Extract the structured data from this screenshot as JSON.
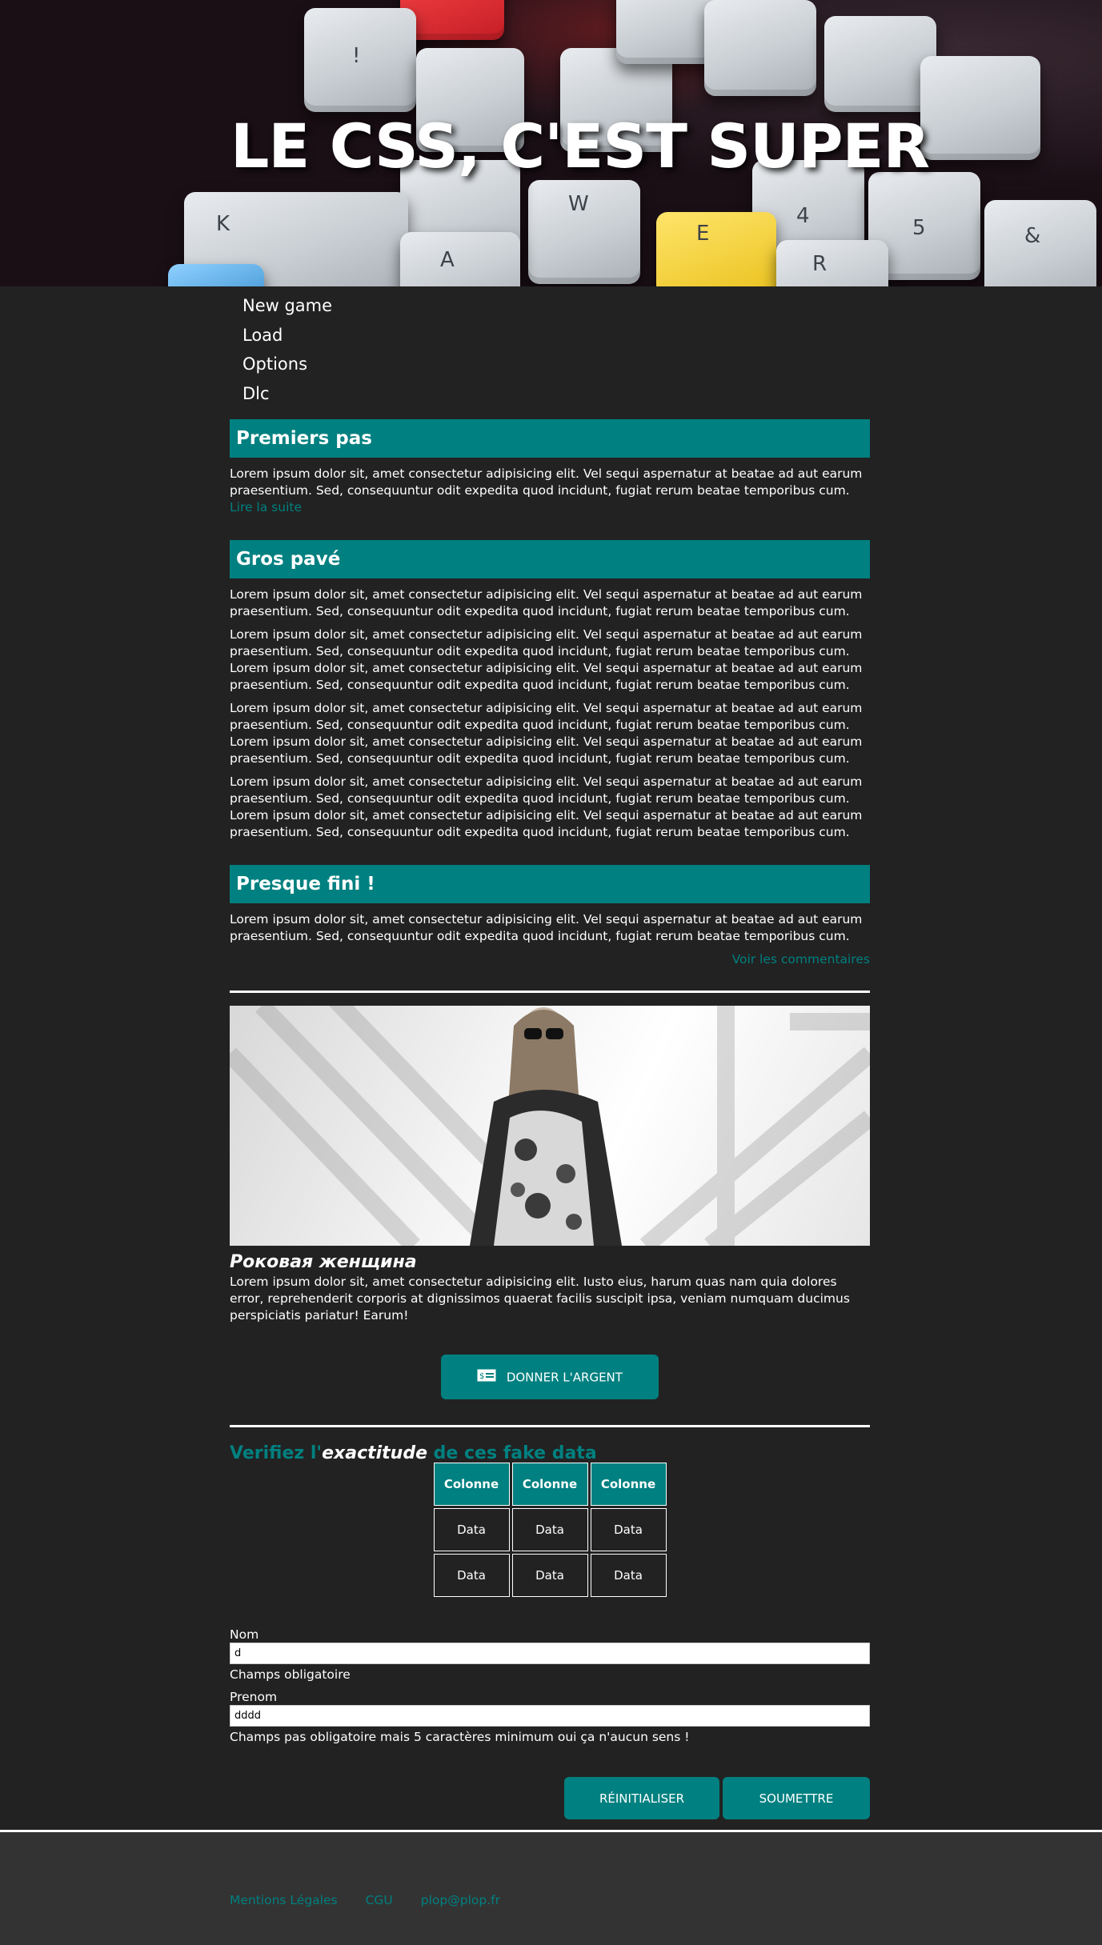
{
  "hero": {
    "title": "LE CSS, C'EST SUPER"
  },
  "nav": {
    "items": [
      {
        "label": "New game"
      },
      {
        "label": "Load"
      },
      {
        "label": "Options"
      },
      {
        "label": "Dlc"
      }
    ]
  },
  "sections": [
    {
      "title": "Premiers pas",
      "paragraphs": [
        "Lorem ipsum dolor sit, amet consectetur adipisicing elit. Vel sequi aspernatur at beatae ad aut earum praesentium. Sed, consequuntur odit expedita quod incidunt, fugiat rerum beatae temporibus cum."
      ],
      "link": "Lire la suite"
    },
    {
      "title": "Gros pavé",
      "paragraphs": [
        "Lorem ipsum dolor sit, amet consectetur adipisicing elit. Vel sequi aspernatur at beatae ad aut earum praesentium. Sed, consequuntur odit expedita quod incidunt, fugiat rerum beatae temporibus cum.",
        "Lorem ipsum dolor sit, amet consectetur adipisicing elit. Vel sequi aspernatur at beatae ad aut earum praesentium. Sed, consequuntur odit expedita quod incidunt, fugiat rerum beatae temporibus cum. Lorem ipsum dolor sit, amet consectetur adipisicing elit. Vel sequi aspernatur at beatae ad aut earum praesentium. Sed, consequuntur odit expedita quod incidunt, fugiat rerum beatae temporibus cum.",
        "Lorem ipsum dolor sit, amet consectetur adipisicing elit. Vel sequi aspernatur at beatae ad aut earum praesentium. Sed, consequuntur odit expedita quod incidunt, fugiat rerum beatae temporibus cum. Lorem ipsum dolor sit, amet consectetur adipisicing elit. Vel sequi aspernatur at beatae ad aut earum praesentium. Sed, consequuntur odit expedita quod incidunt, fugiat rerum beatae temporibus cum.",
        "Lorem ipsum dolor sit, amet consectetur adipisicing elit. Vel sequi aspernatur at beatae ad aut earum praesentium. Sed, consequuntur odit expedita quod incidunt, fugiat rerum beatae temporibus cum. Lorem ipsum dolor sit, amet consectetur adipisicing elit. Vel sequi aspernatur at beatae ad aut earum praesentium. Sed, consequuntur odit expedita quod incidunt, fugiat rerum beatae temporibus cum."
      ]
    },
    {
      "title": "Presque fini !",
      "paragraphs": [
        "Lorem ipsum dolor sit, amet consectetur adipisicing elit. Vel sequi aspernatur at beatae ad aut earum praesentium. Sed, consequuntur odit expedita quod incidunt, fugiat rerum beatae temporibus cum."
      ],
      "link": "Voir les commentaires"
    }
  ],
  "figure": {
    "title": "Роковая женщина",
    "text": "Lorem ipsum dolor sit, amet consectetur adipisicing elit. Iusto eius, harum quas nam quia dolores error, reprehenderit corporis at dignissimos quaerat facilis suscipit ipsa, veniam numquam ducimus perspiciatis pariatur! Earum!"
  },
  "donate": {
    "label": "DONNER L'ARGENT",
    "icon": "money-bill-icon"
  },
  "table": {
    "title_before": "Verifiez l'",
    "title_em": "exactitude",
    "title_after": " de ces fake data",
    "headers": [
      "Colonne",
      "Colonne",
      "Colonne"
    ],
    "rows": [
      [
        "Data",
        "Data",
        "Data"
      ],
      [
        "Data",
        "Data",
        "Data"
      ]
    ]
  },
  "form": {
    "nom": {
      "label": "Nom",
      "value": "d",
      "help": "Champs obligatoire"
    },
    "prenom": {
      "label": "Prenom",
      "value": "dddd",
      "help": "Champs pas obligatoire mais 5 caractères minimum oui ça n'aucun sens !"
    },
    "reset_label": "RÉINITIALISER",
    "submit_label": "SOUMETTRE"
  },
  "footer": {
    "links": [
      "Mentions Légales",
      "CGU",
      "plop@plop.fr"
    ]
  },
  "colors": {
    "accent": "#008080",
    "background": "#222222",
    "footer": "#333333"
  }
}
